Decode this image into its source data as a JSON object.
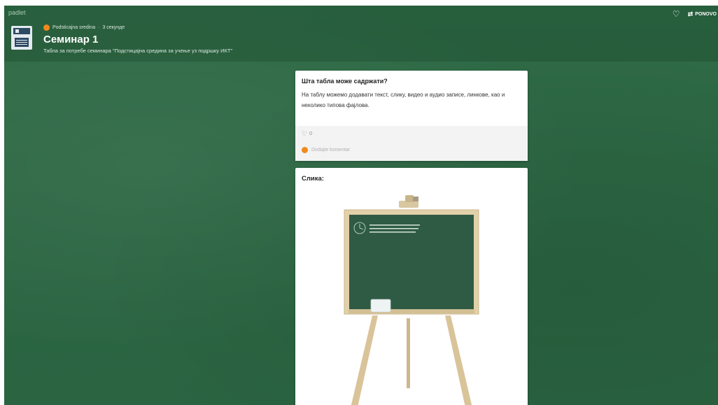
{
  "app": {
    "brand": "padlet"
  },
  "toolbar": {
    "ponovo_label": "PONOVO"
  },
  "wall": {
    "author": "Podsticajna sredina",
    "time_ago": "3 секунде",
    "title": "Семинар 1",
    "description": "Табла за потребе семинара \"Подстицајна средина за учење уз подршку ИКТ\""
  },
  "posts": [
    {
      "title": "Шта табла може садржати?",
      "body": "На таблу можемо додавати текст, слику, видео и аудио записе, линкове, као и неколико типова фајлова.",
      "likes": "0",
      "comment_placeholder": "Dodajte komentar"
    },
    {
      "title": "Слика:",
      "image_alt": "chalkboard on easel"
    }
  ],
  "colors": {
    "background": "#2c6743",
    "accent": "#f08a1c",
    "card": "#ffffff"
  },
  "icons": [
    "save-icon",
    "heart-icon",
    "swap-icon"
  ]
}
